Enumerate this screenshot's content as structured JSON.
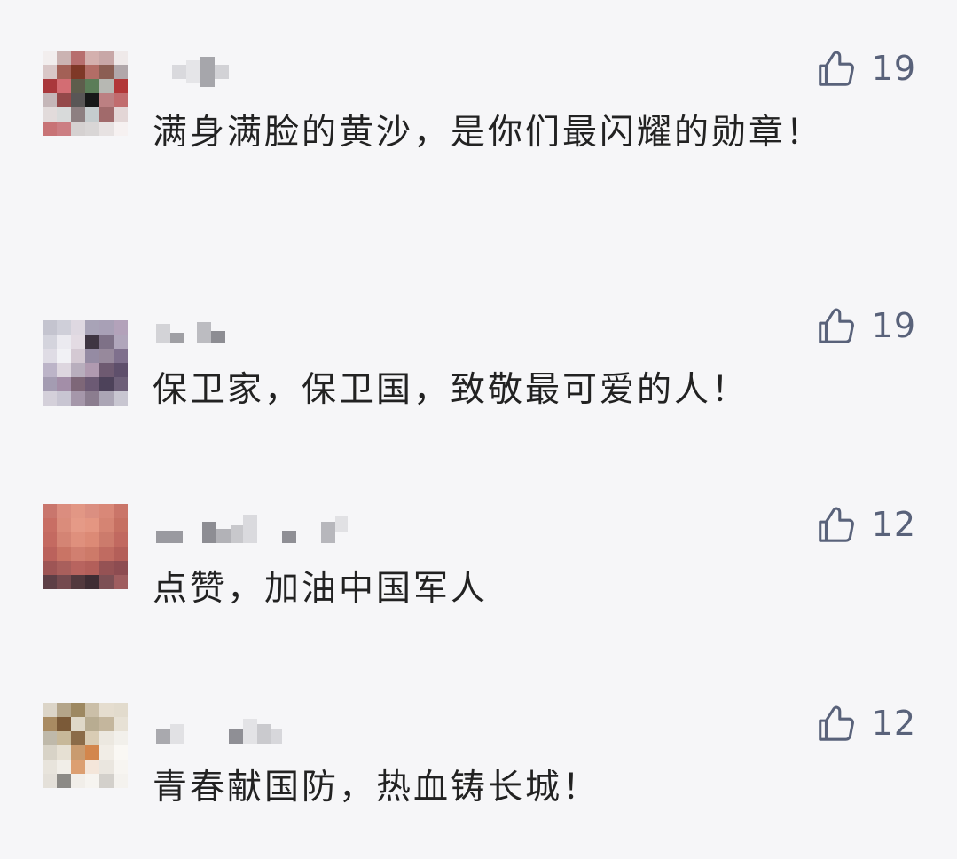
{
  "comments": [
    {
      "avatar_colors": [
        "#f2eeee",
        "#cbb3b2",
        "#b76e6e",
        "#d4b0ae",
        "#c8a7a7",
        "#efe9e9",
        "#d9c7c7",
        "#a36056",
        "#7f3827",
        "#b36d66",
        "#8b5e53",
        "#b1a7aa",
        "#a9383c",
        "#d36d73",
        "#5e5d4c",
        "#5b7d58",
        "#b7b8b3",
        "#b23738",
        "#c5b7b9",
        "#94494a",
        "#595656",
        "#171818",
        "#bc8082",
        "#c16c6e",
        "#e2dbdb",
        "#d8dada",
        "#8d7f81",
        "#c5ccce",
        "#a16a6b",
        "#e3d6d6",
        "#c87376",
        "#cc7e83",
        "#d5d1d1",
        "#d9d6d6",
        "#e7e2e2",
        "#f6f1f1"
      ],
      "like_count": "19",
      "text": "满身满脸的黄沙，是你们最闪耀的勋章！"
    },
    {
      "avatar_colors": [
        "#c4c4cf",
        "#cfcfd9",
        "#ded8e1",
        "#a8a3b7",
        "#a8a0b6",
        "#b3a2ba",
        "#d4d4dd",
        "#ebeaf0",
        "#e3dbe3",
        "#3f3542",
        "#7e7187",
        "#b0a6bb",
        "#dfdce5",
        "#f1f1f5",
        "#d4c9d3",
        "#958ba3",
        "#97899c",
        "#7f708d",
        "#bcb4c8",
        "#ddd6df",
        "#b8aebd",
        "#b09ab0",
        "#6e5a71",
        "#5e4f6b",
        "#a49cb2",
        "#a38ea8",
        "#7e6778",
        "#6c5a74",
        "#4d425a",
        "#6d5f78",
        "#d4d0da",
        "#c8c5d2",
        "#a597aa",
        "#8b7d8f",
        "#aba5b5",
        "#c8c6d1"
      ],
      "like_count": "19",
      "text": "保卫家，保卫国，致敬最可爱的人！"
    },
    {
      "avatar_colors": [
        "#c9766d",
        "#db8d7f",
        "#e29785",
        "#db8f81",
        "#d98878",
        "#ca7569",
        "#c86e64",
        "#da8c7b",
        "#e59a87",
        "#e49682",
        "#d58473",
        "#c67062",
        "#c46a61",
        "#d48474",
        "#df907d",
        "#dc8a76",
        "#cc7b6c",
        "#c16960",
        "#bb625c",
        "#c97465",
        "#d17f70",
        "#cd7a69",
        "#c06b61",
        "#b45f59",
        "#9e5555",
        "#a95f5c",
        "#b8645f",
        "#b35f5a",
        "#955254",
        "#8d4c51",
        "#5d3f46",
        "#744a4f",
        "#52393e",
        "#3f2d34",
        "#7c4f54",
        "#9f5d5f"
      ],
      "like_count": "12",
      "text": "点赞，加油中国军人"
    },
    {
      "avatar_colors": [
        "#dcd5c8",
        "#b4a58a",
        "#9d8861",
        "#cbbfa8",
        "#e5ddcf",
        "#e2dbcd",
        "#a98b62",
        "#7b5a38",
        "#dfd8c8",
        "#b8ac91",
        "#c4b69d",
        "#e7e1d5",
        "#bfb9aa",
        "#c7b899",
        "#8b6b48",
        "#d9ccb4",
        "#ece8e0",
        "#f2f0eb",
        "#d8d3c7",
        "#e6e0d3",
        "#c99b6f",
        "#d3864c",
        "#f1ede6",
        "#faf8f4",
        "#e8e4dc",
        "#f1eee8",
        "#dc9f71",
        "#f4e6da",
        "#eae6df",
        "#f7f5f1",
        "#e4e0d9",
        "#8c8a86",
        "#f1eee9",
        "#f6f4f0",
        "#d3d0cb",
        "#f4f2ee"
      ],
      "like_count": "12",
      "text": "青春献国防，热血铸长城！"
    }
  ],
  "ui": {
    "like_icon": "thumbs-up-icon",
    "colors": {
      "background": "#f6f6f8",
      "text": "#222222",
      "like": "#59627a"
    }
  }
}
